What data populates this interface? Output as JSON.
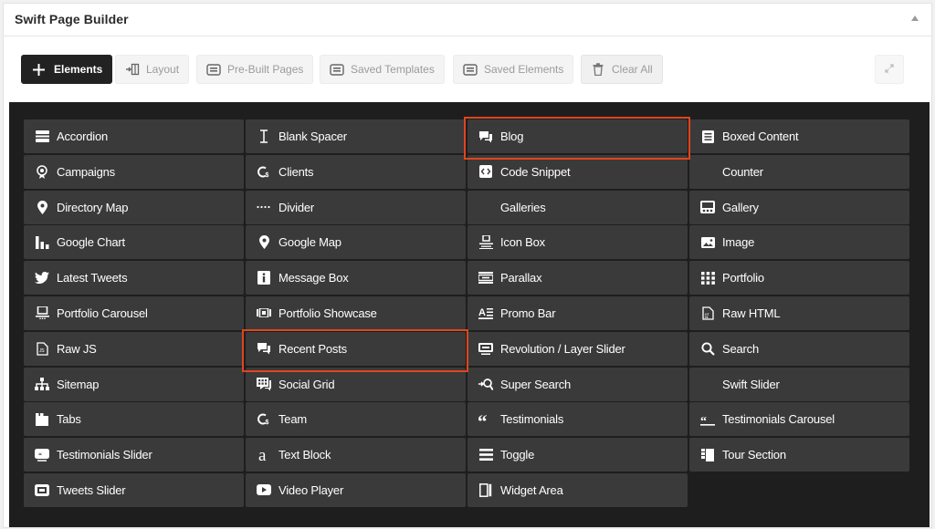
{
  "panel": {
    "title": "Swift Page Builder"
  },
  "toolbar": {
    "elements": "Elements",
    "layout": "Layout",
    "prebuilt": "Pre-Built Pages",
    "saved_templates": "Saved Templates",
    "saved_elements": "Saved Elements",
    "clear_all": "Clear All"
  },
  "colors": {
    "highlight": "#e0451f",
    "grid_bg": "#1e1e1e",
    "tile_bg": "#3a3a3a"
  },
  "elements": [
    {
      "label": "Accordion",
      "icon": "accordion-icon"
    },
    {
      "label": "Blank Spacer",
      "icon": "text-cursor-icon"
    },
    {
      "label": "Blog",
      "icon": "chat-bubbles-icon"
    },
    {
      "label": "Boxed Content",
      "icon": "document-icon"
    },
    {
      "label": "Campaigns",
      "icon": "campaign-icon"
    },
    {
      "label": "Clients",
      "icon": "clients-icon"
    },
    {
      "label": "Code Snippet",
      "icon": "code-icon"
    },
    {
      "label": "Counter",
      "icon": "none"
    },
    {
      "label": "Directory Map",
      "icon": "map-pin-icon"
    },
    {
      "label": "Divider",
      "icon": "dots-icon"
    },
    {
      "label": "Galleries",
      "icon": "none"
    },
    {
      "label": "Gallery",
      "icon": "gallery-icon"
    },
    {
      "label": "Google Chart",
      "icon": "bar-chart-icon"
    },
    {
      "label": "Google Map",
      "icon": "map-pin-icon"
    },
    {
      "label": "Icon Box",
      "icon": "icon-box-icon"
    },
    {
      "label": "Image",
      "icon": "image-icon"
    },
    {
      "label": "Latest Tweets",
      "icon": "twitter-bird-icon"
    },
    {
      "label": "Message Box",
      "icon": "info-icon"
    },
    {
      "label": "Parallax",
      "icon": "parallax-icon"
    },
    {
      "label": "Portfolio",
      "icon": "grid-icon"
    },
    {
      "label": "Portfolio Carousel",
      "icon": "carousel-icon"
    },
    {
      "label": "Portfolio Showcase",
      "icon": "showcase-icon"
    },
    {
      "label": "Promo Bar",
      "icon": "promo-bar-icon"
    },
    {
      "label": "Raw HTML",
      "icon": "html-file-icon"
    },
    {
      "label": "Raw JS",
      "icon": "js-file-icon"
    },
    {
      "label": "Recent Posts",
      "icon": "chat-bubbles-icon"
    },
    {
      "label": "Revolution / Layer Slider",
      "icon": "slider-icon"
    },
    {
      "label": "Search",
      "icon": "search-icon"
    },
    {
      "label": "Sitemap",
      "icon": "sitemap-icon"
    },
    {
      "label": "Social Grid",
      "icon": "social-grid-icon"
    },
    {
      "label": "Super Search",
      "icon": "super-search-icon"
    },
    {
      "label": "Swift Slider",
      "icon": "none"
    },
    {
      "label": "Tabs",
      "icon": "tabs-icon"
    },
    {
      "label": "Team",
      "icon": "clients-icon"
    },
    {
      "label": "Testimonials",
      "icon": "quote-icon"
    },
    {
      "label": "Testimonials Carousel",
      "icon": "quote-small-icon"
    },
    {
      "label": "Testimonials Slider",
      "icon": "testimonial-slider-icon"
    },
    {
      "label": "Text Block",
      "icon": "text-a-icon"
    },
    {
      "label": "Toggle",
      "icon": "hamburger-icon"
    },
    {
      "label": "Tour Section",
      "icon": "tour-icon"
    },
    {
      "label": "Tweets Slider",
      "icon": "tweets-slider-icon"
    },
    {
      "label": "Video Player",
      "icon": "play-icon"
    },
    {
      "label": "Widget Area",
      "icon": "widget-icon"
    }
  ]
}
